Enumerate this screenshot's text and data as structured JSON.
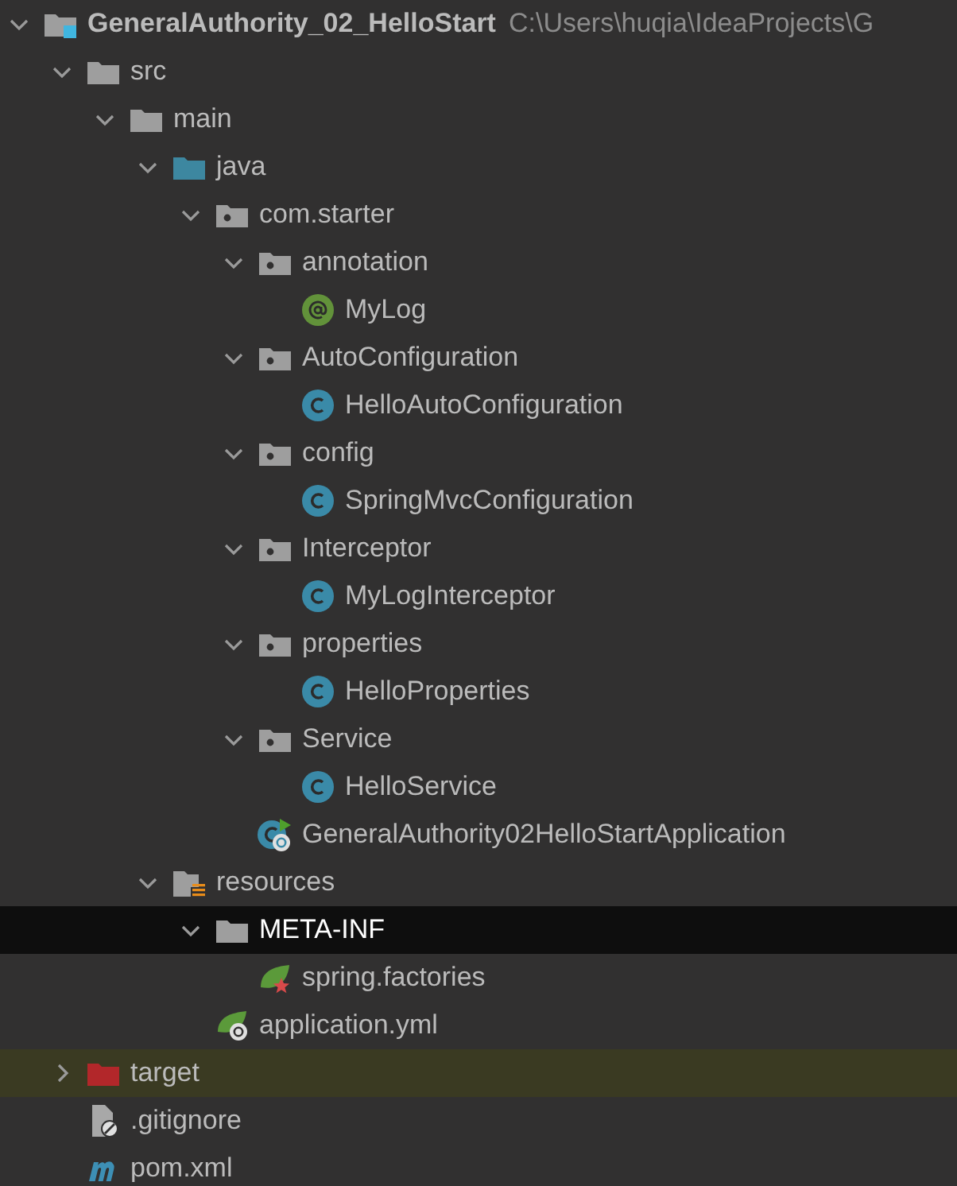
{
  "project_tree": {
    "nodes": [
      {
        "label": "GeneralAuthority_02_HelloStart",
        "path": "C:\\Users\\huqia\\IdeaProjects\\G",
        "kind": "module",
        "expanded": true,
        "selected": false,
        "excluded": false,
        "children": [
          {
            "label": "src",
            "kind": "folder",
            "expanded": true,
            "selected": false,
            "excluded": false,
            "children": [
              {
                "label": "main",
                "kind": "folder",
                "expanded": true,
                "selected": false,
                "excluded": false,
                "children": [
                  {
                    "label": "java",
                    "kind": "source-folder",
                    "expanded": true,
                    "selected": false,
                    "excluded": false,
                    "children": [
                      {
                        "label": "com.starter",
                        "kind": "package",
                        "expanded": true,
                        "selected": false,
                        "excluded": false,
                        "children": [
                          {
                            "label": "annotation",
                            "kind": "package",
                            "expanded": true,
                            "selected": false,
                            "excluded": false,
                            "children": [
                              {
                                "label": "MyLog",
                                "kind": "annotation",
                                "selected": false,
                                "excluded": false
                              }
                            ]
                          },
                          {
                            "label": "AutoConfiguration",
                            "kind": "package",
                            "expanded": true,
                            "selected": false,
                            "excluded": false,
                            "children": [
                              {
                                "label": "HelloAutoConfiguration",
                                "kind": "class",
                                "selected": false,
                                "excluded": false
                              }
                            ]
                          },
                          {
                            "label": "config",
                            "kind": "package",
                            "expanded": true,
                            "selected": false,
                            "excluded": false,
                            "children": [
                              {
                                "label": "SpringMvcConfiguration",
                                "kind": "class",
                                "selected": false,
                                "excluded": false
                              }
                            ]
                          },
                          {
                            "label": "Interceptor",
                            "kind": "package",
                            "expanded": true,
                            "selected": false,
                            "excluded": false,
                            "children": [
                              {
                                "label": "MyLogInterceptor",
                                "kind": "class",
                                "selected": false,
                                "excluded": false
                              }
                            ]
                          },
                          {
                            "label": "properties",
                            "kind": "package",
                            "expanded": true,
                            "selected": false,
                            "excluded": false,
                            "children": [
                              {
                                "label": "HelloProperties",
                                "kind": "class",
                                "selected": false,
                                "excluded": false
                              }
                            ]
                          },
                          {
                            "label": "Service",
                            "kind": "package",
                            "expanded": true,
                            "selected": false,
                            "excluded": false,
                            "children": [
                              {
                                "label": "HelloService",
                                "kind": "class",
                                "selected": false,
                                "excluded": false
                              }
                            ]
                          },
                          {
                            "label": "GeneralAuthority02HelloStartApplication",
                            "kind": "boot-class",
                            "selected": false,
                            "excluded": false
                          }
                        ]
                      }
                    ]
                  },
                  {
                    "label": "resources",
                    "kind": "resources-folder",
                    "expanded": true,
                    "selected": false,
                    "excluded": false,
                    "children": [
                      {
                        "label": "META-INF",
                        "kind": "folder",
                        "expanded": true,
                        "selected": true,
                        "excluded": false,
                        "children": [
                          {
                            "label": "spring.factories",
                            "kind": "spring-factories",
                            "selected": false,
                            "excluded": false
                          }
                        ]
                      },
                      {
                        "label": "application.yml",
                        "kind": "spring-config",
                        "selected": false,
                        "excluded": false
                      }
                    ]
                  }
                ]
              }
            ]
          },
          {
            "label": "target",
            "kind": "excluded-folder",
            "expanded": false,
            "selected": false,
            "excluded": true
          },
          {
            "label": ".gitignore",
            "kind": "ignore-file",
            "selected": false,
            "excluded": false
          },
          {
            "label": "pom.xml",
            "kind": "maven-file",
            "selected": false,
            "excluded": false
          }
        ]
      }
    ]
  }
}
